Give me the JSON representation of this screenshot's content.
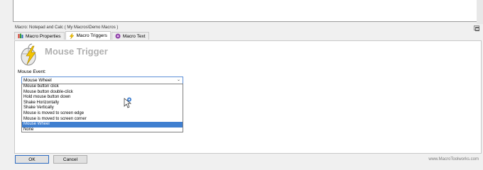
{
  "window": {
    "title": "Macro: Notepad and Calc ( My Macros\\Demo Macros )"
  },
  "tabs": [
    {
      "label": "Macro Properties",
      "icon": "properties-icon",
      "active": false
    },
    {
      "label": "Macro Triggers",
      "icon": "lightning-icon",
      "active": true
    },
    {
      "label": "Macro Text",
      "icon": "script-icon",
      "active": false
    }
  ],
  "trigger": {
    "title": "Mouse Trigger",
    "icon": "mouse-trigger-icon"
  },
  "mouse_event": {
    "label": "Mouse Event:",
    "selected": "Mouse Wheel",
    "options": [
      "Mouse button click",
      "Mouse button double-click",
      "Hold mouse button down",
      "Shake Horizontally",
      "Shake Vertically",
      "Mouse is moved to screen edge",
      "Mouse is moved to screen corner",
      "Mouse Wheel",
      "None"
    ],
    "selected_index": 7
  },
  "buttons": {
    "ok": "OK",
    "cancel": "Cancel"
  },
  "footer": {
    "website": "www.MacroToolworks.com"
  },
  "colors": {
    "selection": "#3f7fd0",
    "combo_border": "#5c8fd6"
  }
}
